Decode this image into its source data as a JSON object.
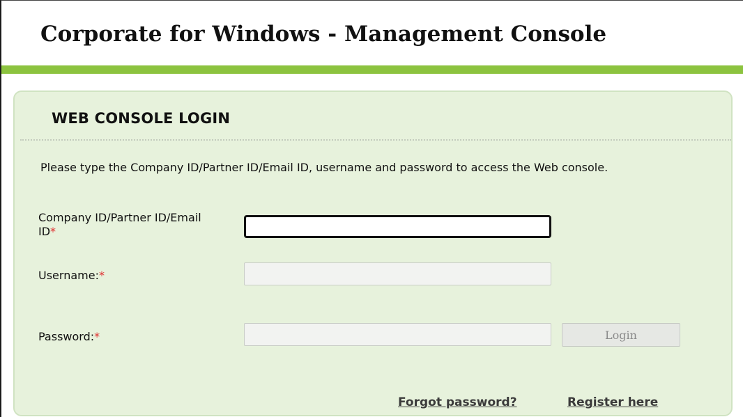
{
  "app": {
    "title": "Corporate for Windows - Management Console"
  },
  "login_panel": {
    "title": "WEB CONSOLE LOGIN",
    "instructions": "Please type the Company ID/Partner ID/Email ID, username and password to access the Web console.",
    "required_marker": "*",
    "fields": {
      "company": {
        "label": "Company ID/Partner ID/Email ID",
        "value": "",
        "placeholder": ""
      },
      "username": {
        "label": "Username:",
        "value": "",
        "placeholder": ""
      },
      "password": {
        "label": "Password:",
        "value": "",
        "placeholder": ""
      }
    },
    "login_button": "Login",
    "links": {
      "forgot_password": "Forgot password?",
      "register": "Register here"
    }
  },
  "colors": {
    "accent_bar": "#8cc33f",
    "panel_background": "#e7f2dc",
    "required_marker": "#e03030"
  }
}
